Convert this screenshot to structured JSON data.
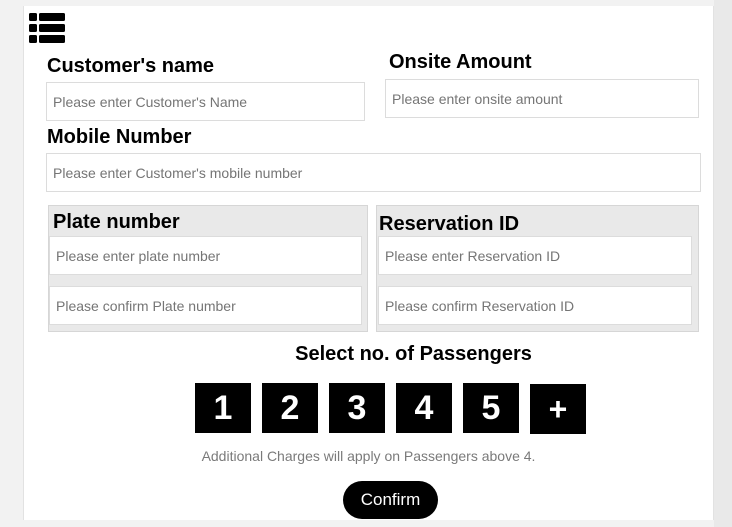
{
  "header": {
    "menu_icon": "list-menu-icon"
  },
  "form": {
    "customer_name": {
      "label": "Customer's name",
      "placeholder": "Please enter Customer's Name"
    },
    "onsite_amount": {
      "label": "Onsite Amount",
      "placeholder": "Please enter onsite amount"
    },
    "mobile_number": {
      "label": "Mobile Number",
      "placeholder": "Please enter Customer's mobile number"
    },
    "plate_number": {
      "label": "Plate number",
      "placeholder": "Please enter plate number",
      "confirm_placeholder": "Please confirm Plate number"
    },
    "reservation_id": {
      "label": "Reservation ID",
      "placeholder": "Please enter Reservation ID",
      "confirm_placeholder": "Please confirm Reservation ID"
    }
  },
  "passengers": {
    "title": "Select no. of Passengers",
    "options": [
      "1",
      "2",
      "3",
      "4",
      "5",
      "+"
    ],
    "note": "Additional Charges will apply on Passengers above 4."
  },
  "confirm_label": "Confirm"
}
